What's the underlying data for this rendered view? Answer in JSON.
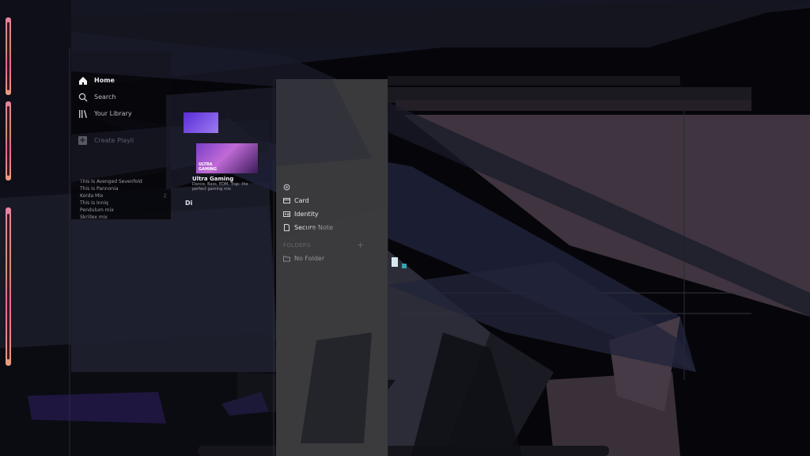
{
  "colors": {
    "background": "#06060a",
    "accent_purple": "#5a2cd8",
    "neon_pink": "#ff8fb0",
    "mauve": "#3f343f"
  },
  "spotify": {
    "nav": [
      {
        "label": "Home",
        "icon": "home-icon"
      },
      {
        "label": "Search",
        "icon": "search-icon"
      },
      {
        "label": "Your Library",
        "icon": "library-icon"
      }
    ],
    "create_playlist_label": "Create Playli",
    "playlists": [
      {
        "label": "This Is Avenged Sevenfold",
        "mark": ""
      },
      {
        "label": "This Is Pannonia",
        "mark": ""
      },
      {
        "label": "Korda Mix",
        "mark": "♫"
      },
      {
        "label": "This Is Inniq",
        "mark": ""
      },
      {
        "label": "Pendulum mix",
        "mark": ""
      },
      {
        "label": "Skrillex mix",
        "mark": ""
      }
    ],
    "album": {
      "art_text_line1": "ULTRA",
      "art_text_line2": "GAMING",
      "title": "Ultra Gaming",
      "description": "Dance, Bass, EDM, Trap: the perfect gaming mix",
      "partial_heading": "Di"
    }
  },
  "password_manager": {
    "items": [
      {
        "label": "Card",
        "icon": "card-icon"
      },
      {
        "label": "Identity",
        "icon": "identity-icon"
      },
      {
        "label": "Secure Note",
        "icon": "note-icon"
      }
    ],
    "folders_header": "FOLDERS",
    "add_folder_icon": "plus-icon",
    "folders": [
      {
        "label": "No Folder",
        "icon": "folder-icon"
      }
    ]
  }
}
